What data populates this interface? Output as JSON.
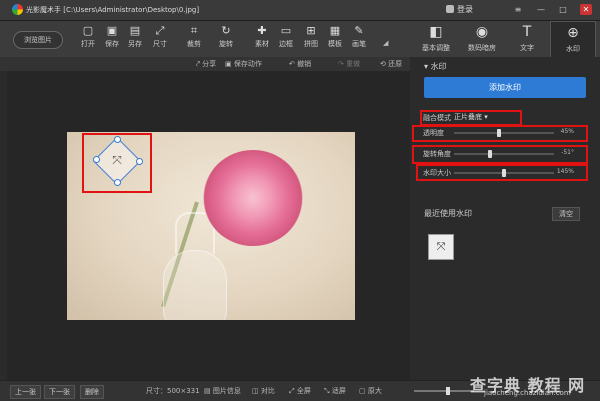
{
  "window": {
    "title": "光影魔术手 [C:\\Users\\Administrator\\Desktop\\0.jpg]",
    "login_label": "登录",
    "controls": [
      "≡",
      "—",
      "□",
      "✕"
    ]
  },
  "toolbar": {
    "browse_label": "浏览图片",
    "tools": [
      {
        "label": "打开",
        "icon": "open-icon",
        "glyph": "▢"
      },
      {
        "label": "保存",
        "icon": "save-icon",
        "glyph": "▣"
      },
      {
        "label": "另存",
        "icon": "save-as-icon",
        "glyph": "▤"
      },
      {
        "label": "尺寸",
        "icon": "resize-icon",
        "glyph": "⤢"
      },
      {
        "label": "裁剪",
        "icon": "crop-icon",
        "glyph": "⌗"
      },
      {
        "label": "旋转",
        "icon": "rotate-icon",
        "glyph": "↻"
      },
      {
        "label": "素材",
        "icon": "material-icon",
        "glyph": "✚"
      },
      {
        "label": "边框",
        "icon": "border-icon",
        "glyph": "▭"
      },
      {
        "label": "拼图",
        "icon": "collage-icon",
        "glyph": "⊞"
      },
      {
        "label": "模板",
        "icon": "template-icon",
        "glyph": "▦"
      },
      {
        "label": "画笔",
        "icon": "brush-icon",
        "glyph": "✎"
      }
    ],
    "more_glyph": "◢"
  },
  "right_tabs": [
    {
      "label": "基本调整",
      "icon": "basic-adjust-icon",
      "glyph": "◧"
    },
    {
      "label": "数码暗房",
      "icon": "darkroom-icon",
      "glyph": "◉"
    },
    {
      "label": "文字",
      "icon": "text-icon",
      "glyph": "T"
    },
    {
      "label": "水印",
      "icon": "watermark-icon",
      "glyph": "⊕"
    }
  ],
  "subbar": {
    "share": "分享",
    "save_action": "保存动作",
    "undo": "撤销",
    "redo": "重做",
    "restore": "还原"
  },
  "watermark_panel": {
    "title": "水印",
    "add_button": "添加水印",
    "blend_mode_label": "融合模式",
    "blend_mode_value": "正片叠底",
    "opacity_label": "透明度",
    "opacity_value": "45%",
    "opacity_fraction": 0.45,
    "rotation_label": "旋转角度",
    "rotation_value": "-51°",
    "rotation_fraction": 0.36,
    "size_label": "水印大小",
    "size_value": "145%",
    "size_fraction": 0.5,
    "recent_label": "最近使用水印",
    "clear_button": "清空",
    "recent_glyph": "⤧"
  },
  "canvas": {
    "watermark_glyph": "⤧"
  },
  "bottombar": {
    "prev": "上一张",
    "next": "下一张",
    "delete": "删除",
    "size_text": "尺寸：500×331",
    "image_info": "图片信息",
    "compare": "对比",
    "fullscreen": "全屏",
    "fit": "适屏",
    "original": "原大"
  },
  "site_watermark": {
    "text": "查字典 教程 网",
    "url": "jiaocheng.chazidian.com"
  },
  "colors": {
    "accent": "#2e7bd6",
    "highlight_box": "#e01212"
  }
}
